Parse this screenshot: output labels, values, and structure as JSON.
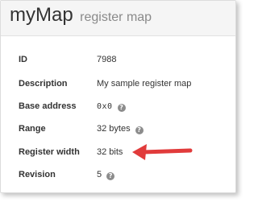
{
  "header": {
    "title": "myMap",
    "subtitle": "register map"
  },
  "rows": [
    {
      "label": "ID",
      "value": "7988",
      "help": false
    },
    {
      "label": "Description",
      "value": "My sample register map",
      "help": false
    },
    {
      "label": "Base address",
      "value": "0x0",
      "help": true
    },
    {
      "label": "Range",
      "value": "32 bytes",
      "help": true
    },
    {
      "label": "Register width",
      "value": "32 bits",
      "help": false
    },
    {
      "label": "Revision",
      "value": "5",
      "help": true
    }
  ],
  "help_icon": {
    "name": "question-circle-icon",
    "glyph": "?"
  },
  "annotation": {
    "name": "arrow-left-icon",
    "color": "#e13b3b"
  }
}
